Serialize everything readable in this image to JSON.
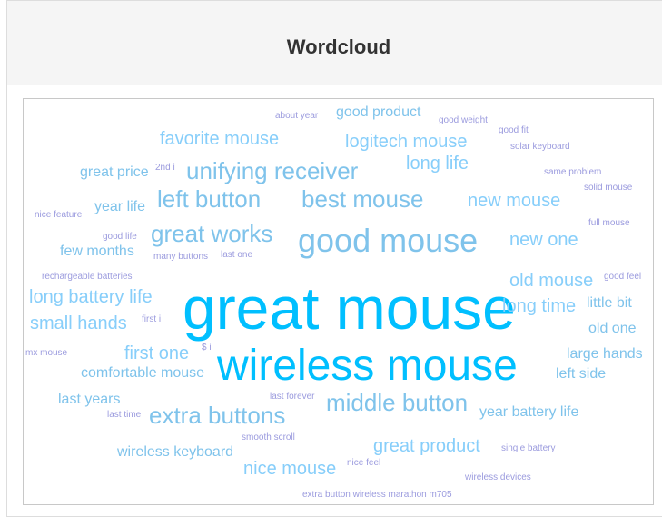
{
  "panel": {
    "title": "Wordcloud"
  },
  "colors": {
    "accent": "#00bfff",
    "blue": "#7fc3eb",
    "lightblue": "#87cefa",
    "purple": "#9b9bde",
    "background": "#ffffff"
  },
  "words": [
    {
      "text": "great mouse",
      "weight": 100
    },
    {
      "text": "wireless mouse",
      "weight": 90
    },
    {
      "text": "good mouse",
      "weight": 70
    },
    {
      "text": "unifying receiver",
      "weight": 45
    },
    {
      "text": "best mouse",
      "weight": 45
    },
    {
      "text": "left button",
      "weight": 45
    },
    {
      "text": "great works",
      "weight": 45
    },
    {
      "text": "extra buttons",
      "weight": 45
    },
    {
      "text": "middle button",
      "weight": 45
    },
    {
      "text": "favorite mouse",
      "weight": 30
    },
    {
      "text": "logitech mouse",
      "weight": 30
    },
    {
      "text": "long life",
      "weight": 30
    },
    {
      "text": "new mouse",
      "weight": 30
    },
    {
      "text": "new one",
      "weight": 30
    },
    {
      "text": "old mouse",
      "weight": 30
    },
    {
      "text": "long time",
      "weight": 30
    },
    {
      "text": "long battery life",
      "weight": 30
    },
    {
      "text": "small hands",
      "weight": 30
    },
    {
      "text": "first one",
      "weight": 30
    },
    {
      "text": "great product",
      "weight": 30
    },
    {
      "text": "nice mouse",
      "weight": 30
    },
    {
      "text": "good product",
      "weight": 25
    },
    {
      "text": "great price",
      "weight": 22
    },
    {
      "text": "year life",
      "weight": 22
    },
    {
      "text": "few months",
      "weight": 22
    },
    {
      "text": "little bit",
      "weight": 22
    },
    {
      "text": "old one",
      "weight": 22
    },
    {
      "text": "large hands",
      "weight": 22
    },
    {
      "text": "left side",
      "weight": 22
    },
    {
      "text": "comfortable mouse",
      "weight": 22
    },
    {
      "text": "last years",
      "weight": 22
    },
    {
      "text": "year battery life",
      "weight": 22
    },
    {
      "text": "wireless keyboard",
      "weight": 22
    },
    {
      "text": "about year",
      "weight": 8
    },
    {
      "text": "good weight",
      "weight": 8
    },
    {
      "text": "good fit",
      "weight": 8
    },
    {
      "text": "solar keyboard",
      "weight": 8
    },
    {
      "text": "2nd i",
      "weight": 8
    },
    {
      "text": "same problem",
      "weight": 8
    },
    {
      "text": "solid mouse",
      "weight": 8
    },
    {
      "text": "nice feature",
      "weight": 8
    },
    {
      "text": "full mouse",
      "weight": 8
    },
    {
      "text": "good life",
      "weight": 8
    },
    {
      "text": "many buttons",
      "weight": 8
    },
    {
      "text": "last one",
      "weight": 8
    },
    {
      "text": "rechargeable batteries",
      "weight": 8
    },
    {
      "text": "good feel",
      "weight": 8
    },
    {
      "text": "first i",
      "weight": 8
    },
    {
      "text": "mx mouse",
      "weight": 8
    },
    {
      "text": "$ i",
      "weight": 8
    },
    {
      "text": "last forever",
      "weight": 8
    },
    {
      "text": "last time",
      "weight": 8
    },
    {
      "text": "smooth scroll",
      "weight": 8
    },
    {
      "text": "single battery",
      "weight": 8
    },
    {
      "text": "nice feel",
      "weight": 8
    },
    {
      "text": "wireless devices",
      "weight": 8
    },
    {
      "text": "extra button wireless marathon m705",
      "weight": 8
    }
  ]
}
